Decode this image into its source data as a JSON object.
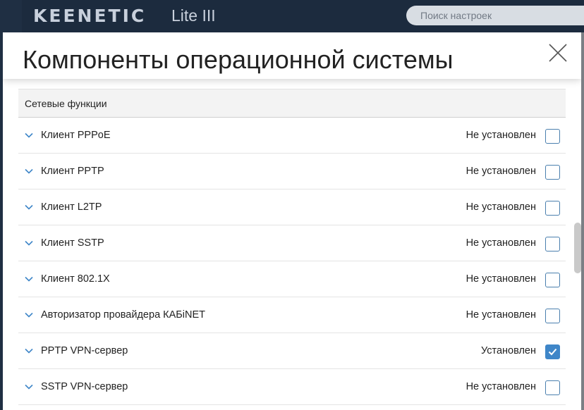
{
  "app": {
    "logo": "KEENETIC",
    "model": "Lite III",
    "search_placeholder": "Поиск настроек"
  },
  "modal": {
    "title": "Компоненты операционной системы",
    "close_icon": "close-icon"
  },
  "section": {
    "title": "Сетевые функции",
    "items": [
      {
        "label": "Клиент PPPoE",
        "status": "Не установлен",
        "checked": false
      },
      {
        "label": "Клиент PPTP",
        "status": "Не установлен",
        "checked": false
      },
      {
        "label": "Клиент L2TP",
        "status": "Не установлен",
        "checked": false
      },
      {
        "label": "Клиент SSTP",
        "status": "Не установлен",
        "checked": false
      },
      {
        "label": "Клиент 802.1X",
        "status": "Не установлен",
        "checked": false
      },
      {
        "label": "Авторизатор провайдера КАБiNET",
        "status": "Не установлен",
        "checked": false
      },
      {
        "label": "PPTP VPN-сервер",
        "status": "Установлен",
        "checked": true
      },
      {
        "label": "SSTP VPN-сервер",
        "status": "Не установлен",
        "checked": false
      }
    ]
  },
  "colors": {
    "accent": "#3f86c8",
    "appbar": "#1c2b3e"
  }
}
